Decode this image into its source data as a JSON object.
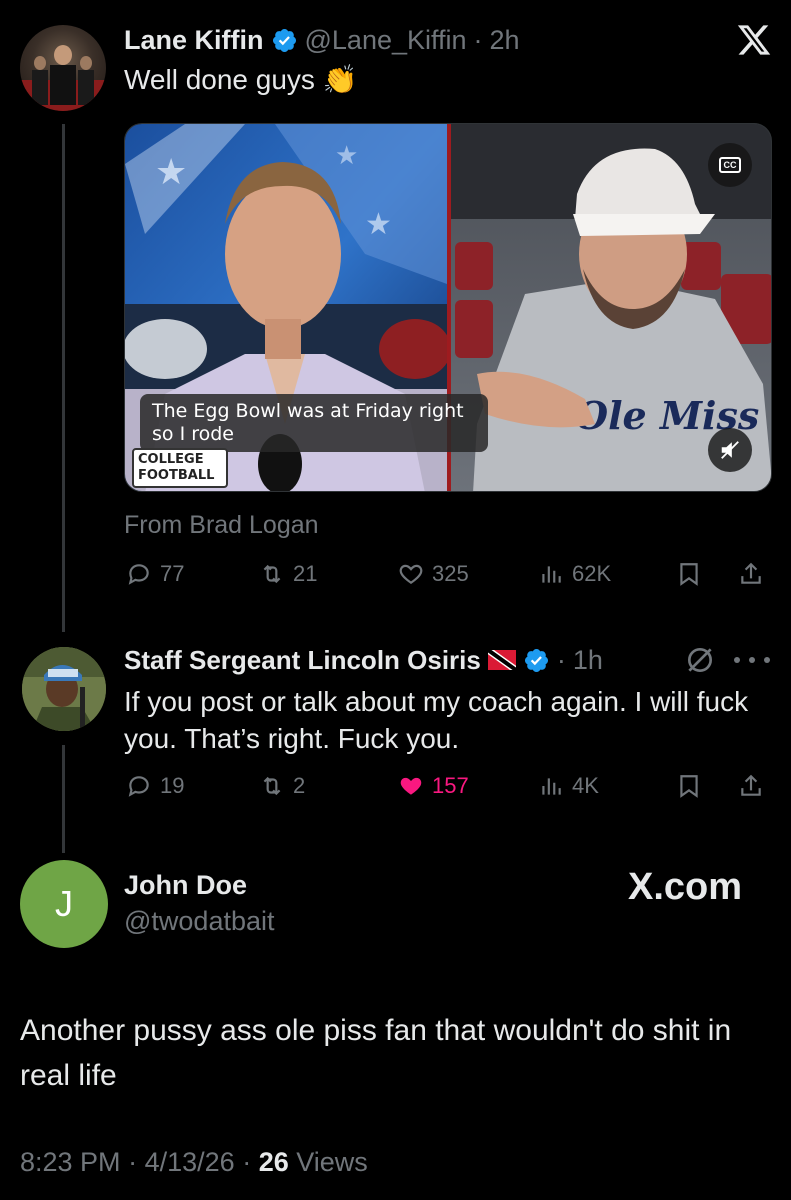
{
  "tweet1": {
    "name": "Lane Kiffin",
    "handle": "@Lane_Kiffin",
    "time": "2h",
    "text": "Well done guys",
    "emoji": "👏",
    "video": {
      "caption": "The Egg Bowl was at Friday right so I rode",
      "cc_label": "CC",
      "overlay_brand": "COLLEGE FOOTBALL",
      "hoodie_text": "Ole Miss"
    },
    "from_label": "From Brad Logan",
    "stats": {
      "replies": "77",
      "reposts": "21",
      "likes": "325",
      "views": "62K"
    }
  },
  "tweet2": {
    "name": "Staff Sergeant Lincoln Osiris",
    "time": "1h",
    "text": "If you post or talk about my coach again. I will fuck you. That’s right. Fuck you.",
    "stats": {
      "replies": "19",
      "reposts": "2",
      "likes": "157",
      "views": "4K"
    }
  },
  "tweet3": {
    "avatar_letter": "J",
    "name": "John Doe",
    "handle": "@twodatbait",
    "brand": "X.com",
    "text": "Another pussy ass ole piss fan that wouldn't do shit in real life",
    "time": "8:23 PM",
    "date": "4/13/26",
    "views_count": "26",
    "views_label": "Views"
  },
  "colors": {
    "background": "#000000",
    "text": "#e7e9ea",
    "muted": "#71767b",
    "verified_blue": "#1d9bf0",
    "like_pink": "#f91880",
    "avatar_green": "#6fa546"
  },
  "icons": [
    "x-logo-icon",
    "verified-icon",
    "reply-icon",
    "repost-icon",
    "like-icon",
    "views-icon",
    "bookmark-icon",
    "share-icon",
    "more-icon",
    "grok-icon",
    "flag-icon",
    "cc-icon",
    "mute-icon"
  ]
}
